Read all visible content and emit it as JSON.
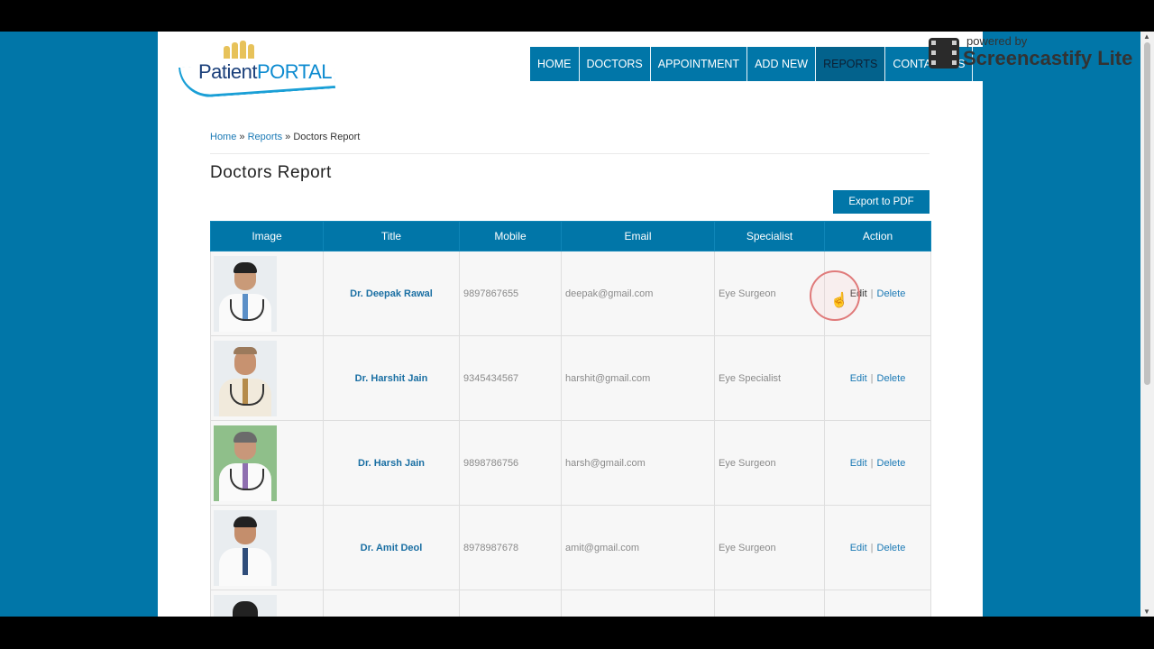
{
  "logo": {
    "text_a": "Patient",
    "text_b": "PORTAL"
  },
  "nav": {
    "items": [
      "HOME",
      "DOCTORS",
      "APPOINTMENT",
      "ADD NEW",
      "REPORTS",
      "CONTACT US"
    ],
    "active": "REPORTS"
  },
  "watermark": {
    "line1": "powered by",
    "line2": "Screencastify Lite"
  },
  "breadcrumb": {
    "home": "Home",
    "sep1": " » ",
    "reports": "Reports",
    "sep2": " » ",
    "current": "Doctors Report"
  },
  "page_title": "Doctors Report",
  "export_label": "Export to PDF",
  "table": {
    "headers": [
      "Image",
      "Title",
      "Mobile",
      "Email",
      "Specialist",
      "Action"
    ],
    "rows": [
      {
        "title": "Dr. Deepak Rawal",
        "mobile": "9897867655",
        "email": "deepak@gmail.com",
        "specialist": "Eye Surgeon",
        "edit": "Edit",
        "delete": "Delete"
      },
      {
        "title": "Dr. Harshit Jain",
        "mobile": "9345434567",
        "email": "harshit@gmail.com",
        "specialist": "Eye Specialist",
        "edit": "Edit",
        "delete": "Delete"
      },
      {
        "title": "Dr. Harsh Jain",
        "mobile": "9898786756",
        "email": "harsh@gmail.com",
        "specialist": "Eye Surgeon",
        "edit": "Edit",
        "delete": "Delete"
      },
      {
        "title": "Dr. Amit Deol",
        "mobile": "8978987678",
        "email": "amit@gmail.com",
        "specialist": "Eye Surgeon",
        "edit": "Edit",
        "delete": "Delete"
      }
    ]
  },
  "colors": {
    "primary": "#0176a8",
    "link": "#1a79b5"
  }
}
